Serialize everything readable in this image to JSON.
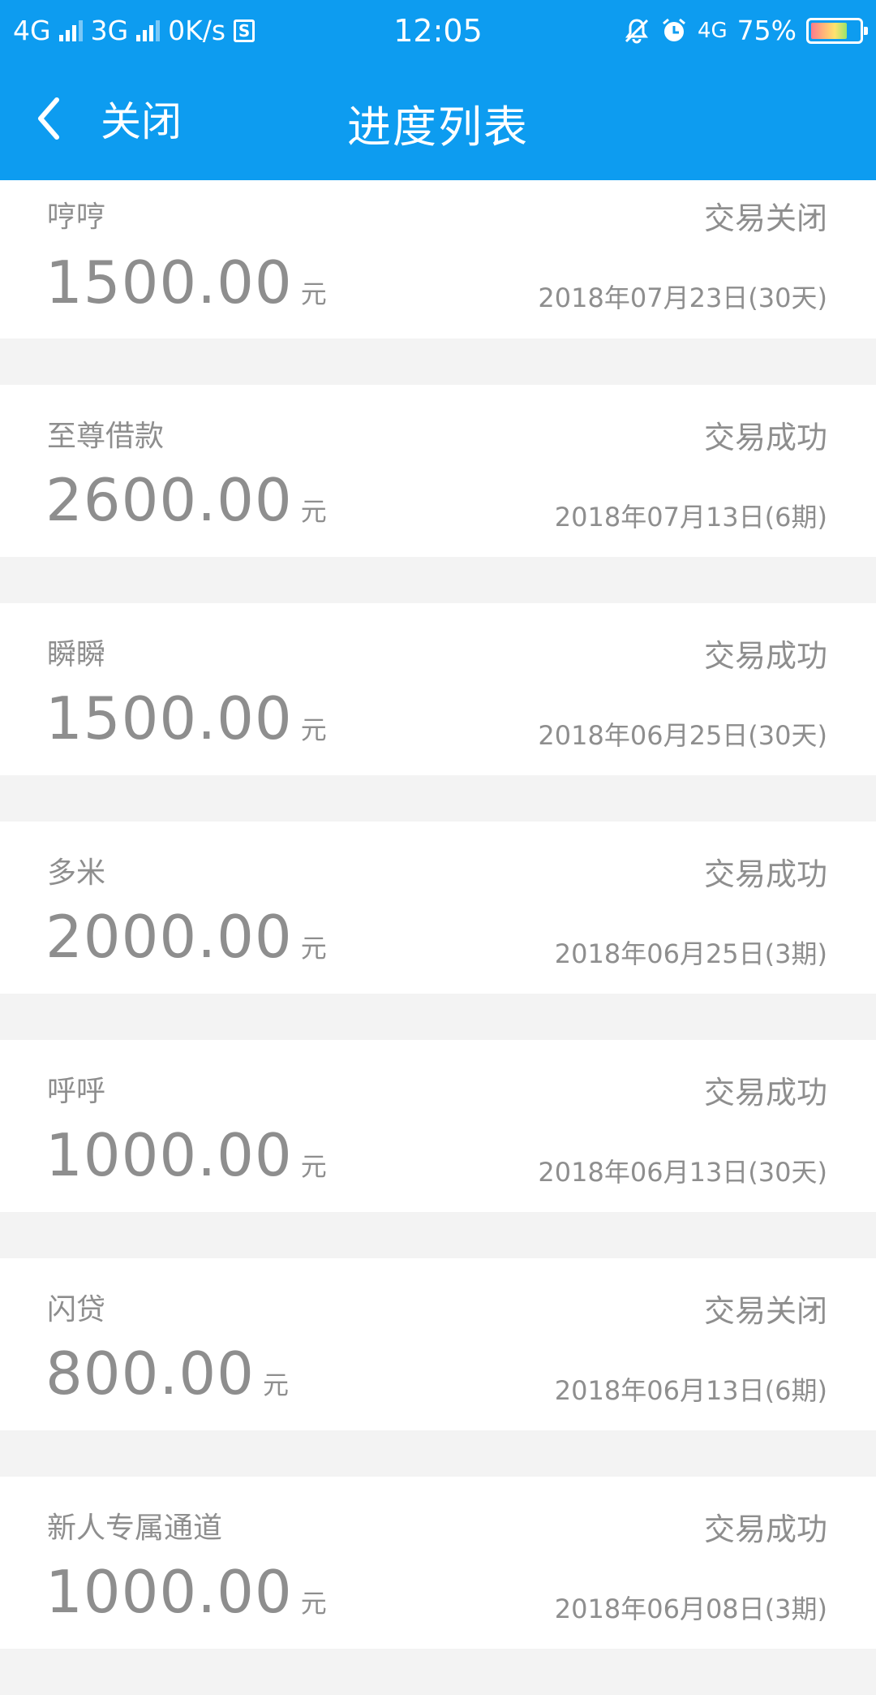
{
  "status_bar": {
    "network1": "4G",
    "network2": "3G",
    "speed": "0K/s",
    "sim_icon_text": "S",
    "time": "12:05",
    "network3": "4G",
    "battery": "75%",
    "battery_level": 0.75,
    "icons": [
      "signal-icon",
      "signal-icon",
      "sim-icon",
      "mute-icon",
      "alarm-icon",
      "battery-icon"
    ]
  },
  "nav": {
    "back_icon": "chevron-left-icon",
    "close_label": "关闭",
    "title": "进度列表"
  },
  "colors": {
    "header": "#0d9cf0",
    "text": "#8e8e8e",
    "background": "#f3f3f3",
    "card": "#ffffff"
  },
  "records": [
    {
      "name": "哼哼",
      "status": "交易关闭",
      "amount": "1500.00",
      "unit": "元",
      "date": "2018年07月23日(30天)"
    },
    {
      "name": "至尊借款",
      "status": "交易成功",
      "amount": "2600.00",
      "unit": "元",
      "date": "2018年07月13日(6期)"
    },
    {
      "name": "瞬瞬",
      "status": "交易成功",
      "amount": "1500.00",
      "unit": "元",
      "date": "2018年06月25日(30天)"
    },
    {
      "name": "多米",
      "status": "交易成功",
      "amount": "2000.00",
      "unit": "元",
      "date": "2018年06月25日(3期)"
    },
    {
      "name": "呼呼",
      "status": "交易成功",
      "amount": "1000.00",
      "unit": "元",
      "date": "2018年06月13日(30天)"
    },
    {
      "name": "闪贷",
      "status": "交易关闭",
      "amount": "800.00",
      "unit": "元",
      "date": "2018年06月13日(6期)"
    },
    {
      "name": "新人专属通道",
      "status": "交易成功",
      "amount": "1000.00",
      "unit": "元",
      "date": "2018年06月08日(3期)"
    }
  ]
}
